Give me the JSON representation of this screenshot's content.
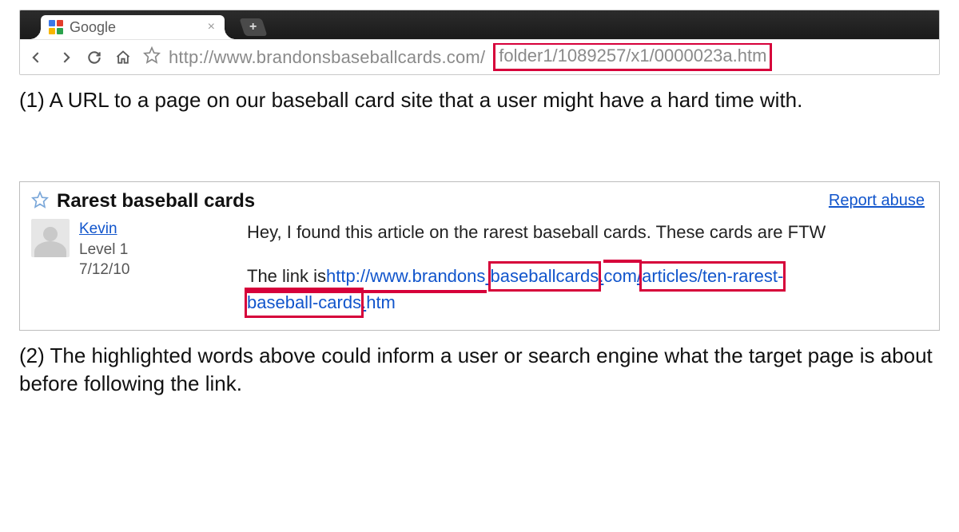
{
  "browser": {
    "tab_title": "Google",
    "url_base": "http://www.brandonsbaseballcards.com/",
    "url_highlight": "folder1/1089257/x1/0000023a.htm"
  },
  "caption1": "(1) A URL to a page on our baseball card site that a user might have a hard time with.",
  "forum": {
    "title": "Rarest baseball cards",
    "report": "Report abuse",
    "user": "Kevin",
    "level": "Level 1",
    "date": "7/12/10",
    "msg": "Hey, I found this article on the rarest baseball cards. These cards are FTW",
    "link_prefix": "The link is ",
    "seg1": "http://www.brandons",
    "seg2": "baseballcards",
    "seg3": "com",
    "seg4": "articles/ten-rarest-",
    "seg5": "baseball-cards",
    "seg6": "htm"
  },
  "caption2": "(2) The highlighted words above could inform a user or search engine what the target page is about before following the link."
}
